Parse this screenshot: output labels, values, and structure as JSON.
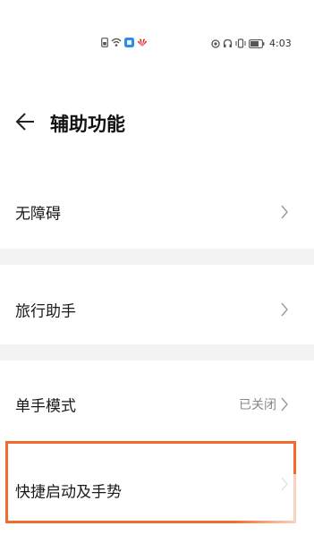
{
  "status_bar": {
    "time": "4:03",
    "left_icons": [
      "sim-icon",
      "wifi-icon",
      "app-icon",
      "huawei-icon"
    ],
    "right_icons": [
      "location-icon",
      "headset-icon",
      "vibrate-icon",
      "battery-icon"
    ]
  },
  "header": {
    "title": "辅助功能"
  },
  "items": [
    {
      "label": "无障碍",
      "value": ""
    },
    {
      "label": "旅行助手",
      "value": ""
    },
    {
      "label": "单手模式",
      "value": "已关闭"
    },
    {
      "label": "快捷启动及手势",
      "value": ""
    }
  ],
  "colors": {
    "highlight": "#f26b2e",
    "divider": "#f3f3f3"
  }
}
